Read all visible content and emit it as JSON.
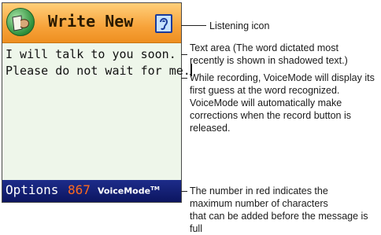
{
  "phone": {
    "header": {
      "title": "Write New",
      "listening_icon": "ear-icon",
      "app_icon": "speaking-head-icon"
    },
    "text_lines": [
      "I will talk to you soon.",
      "Please do not wait for me."
    ],
    "footer": {
      "options_label": "Options",
      "char_count": "867",
      "brand": "VoiceMode",
      "brand_tm": "TM"
    }
  },
  "callouts": {
    "listening": "Listening icon",
    "text_area_l1": "Text area (The word dictated most",
    "text_area_l2": "recently is shown in shadowed text.)",
    "recording_l1": "While recording, VoiceMode will display its",
    "recording_l2": "first guess at the word recognized.",
    "recording_l3": "VoiceMode will automatically make",
    "recording_l4": "corrections when the record button is",
    "recording_l5": "released.",
    "count_l1": "The number in red indicates the",
    "count_l2": "maximum number of characters",
    "count_l3": "that can be added before the message is full"
  },
  "colors": {
    "header": "#f7a33a",
    "footer": "#0c1560",
    "count": "#ff6a1e"
  }
}
